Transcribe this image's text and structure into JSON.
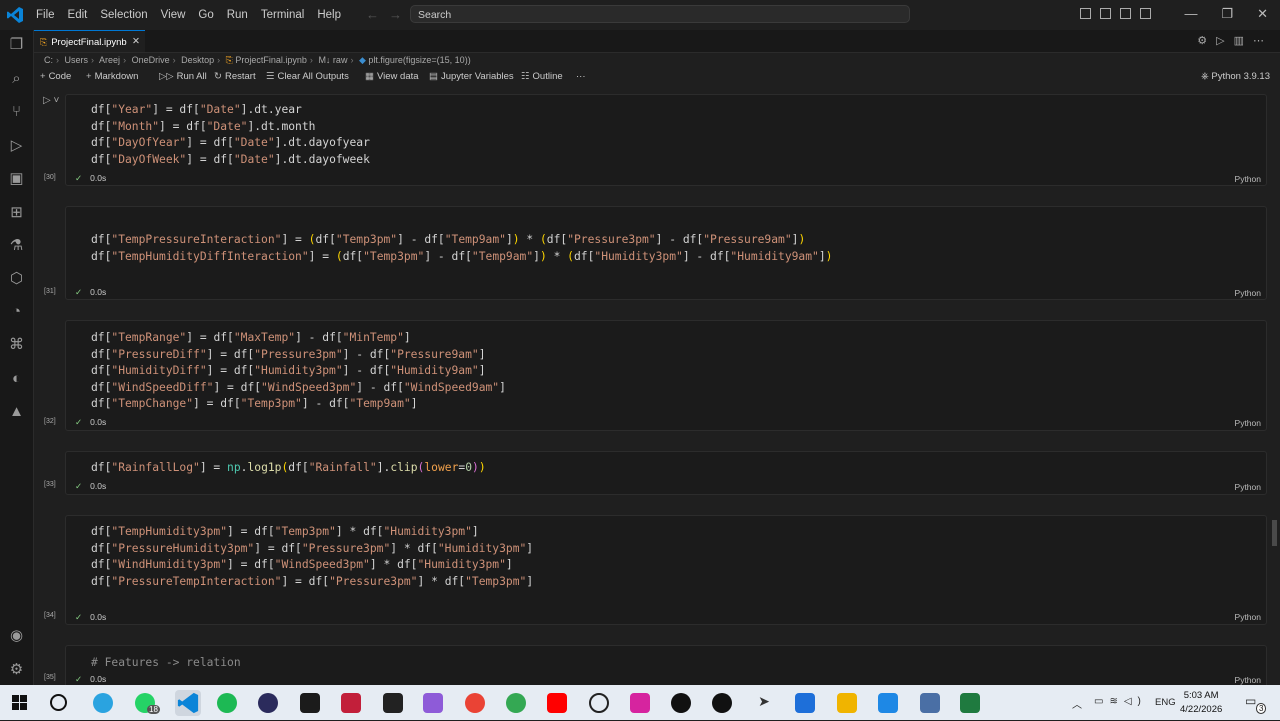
{
  "menu": [
    "File",
    "Edit",
    "Selection",
    "View",
    "Go",
    "Run",
    "Terminal",
    "Help"
  ],
  "search_placeholder": "Search",
  "tab": {
    "label": "ProjectFinal.ipynb"
  },
  "breadcrumb": [
    "C:",
    "Users",
    "Areej",
    "OneDrive",
    "Desktop",
    "ProjectFinal.ipynb",
    "M↓ raw",
    "plt.figure(figsize=(15, 10))"
  ],
  "toolbar": {
    "code": "Code",
    "markdown": "Markdown",
    "run_all": "Run All",
    "restart": "Restart",
    "clear_outputs": "Clear All Outputs",
    "view_data": "View data",
    "jupyter_vars": "Jupyter Variables",
    "outline": "Outline",
    "more": "···",
    "kernel": "Python 3.9.13"
  },
  "cells": [
    {
      "exec": "[30]",
      "time": "0.0s",
      "lang": "Python"
    },
    {
      "exec": "[31]",
      "time": "0.0s",
      "lang": "Python"
    },
    {
      "exec": "[32]",
      "time": "0.0s",
      "lang": "Python"
    },
    {
      "exec": "[33]",
      "time": "0.0s",
      "lang": "Python"
    },
    {
      "exec": "[34]",
      "time": "0.0s",
      "lang": "Python"
    },
    {
      "exec": "[35]",
      "time": "0.0s",
      "lang": "Python",
      "comment": "# Features -> relation"
    }
  ],
  "taskbar": {
    "whatsapp_badge": "18",
    "tray_lang": "ENG",
    "time": "5:03 AM",
    "date": "4/22/2026",
    "notif_count": "3"
  }
}
